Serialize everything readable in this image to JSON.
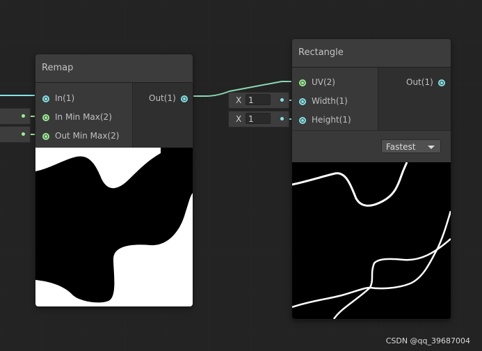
{
  "colors": {
    "vector1": "#84e4e7",
    "vector2": "#9aef92"
  },
  "remap": {
    "title": "Remap",
    "inputs": [
      "In(1)",
      "In Min Max(2)",
      "Out Min Max(2)"
    ],
    "output": "Out(1)"
  },
  "rectangle": {
    "title": "Rectangle",
    "inputs": [
      "UV(2)",
      "Width(1)",
      "Height(1)"
    ],
    "output": "Out(1)",
    "width_field": {
      "label": "X",
      "value": "1"
    },
    "height_field": {
      "label": "X",
      "value": "1"
    },
    "dropdown": "Fastest"
  },
  "watermark": "CSDN @qq_39687004"
}
